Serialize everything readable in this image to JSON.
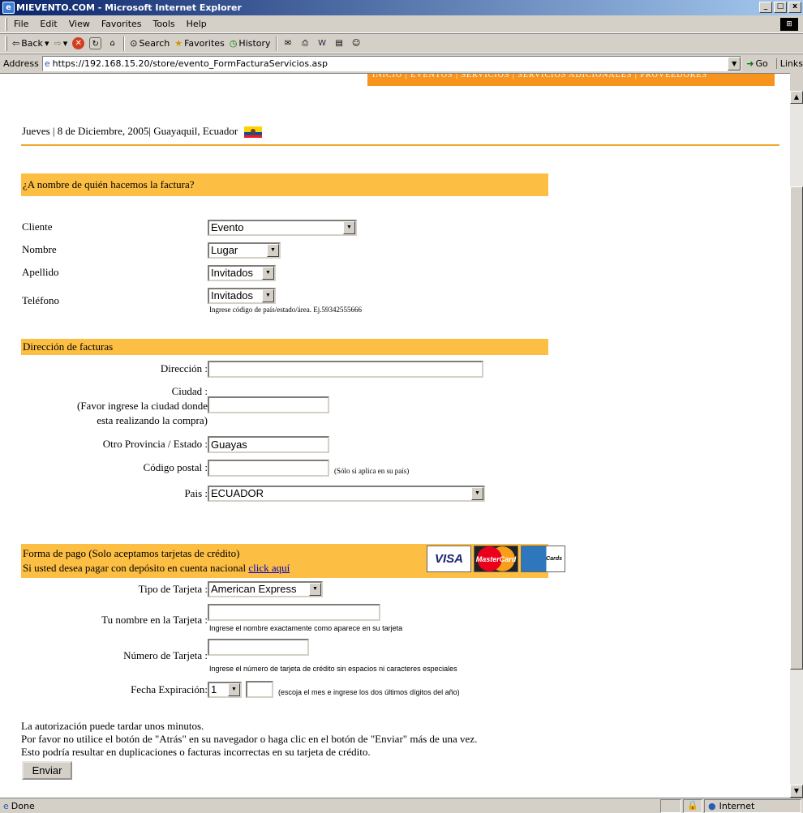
{
  "window": {
    "title": "MIEVENTO.COM - Microsoft Internet Explorer"
  },
  "menu": [
    "File",
    "Edit",
    "View",
    "Favorites",
    "Tools",
    "Help"
  ],
  "toolbar": {
    "back": "Back",
    "search": "Search",
    "favorites": "Favorites",
    "history": "History"
  },
  "address": {
    "label": "Address",
    "url": "https://192.168.15.20/store/evento_FormFacturaServicios.asp",
    "go": "Go",
    "links": "Links"
  },
  "status": {
    "text": "Done",
    "zone": "Internet"
  },
  "page": {
    "topnav": "INICIO | EVENTOS | SERVICIOS | SERVICIOS ADICIONALES | PROVEEDORES",
    "date": "Jueves | 8 de Diciembre, 2005| Guayaquil, Ecuador",
    "billing_header": "¿A nombre de quién hacemos la factura?",
    "billing": {
      "cliente_label": "Cliente",
      "cliente_value": "Evento",
      "nombre_label": "Nombre",
      "nombre_value": "Lugar",
      "apellido_label": "Apellido",
      "apellido_value": "Invitados",
      "telefono_label": "Teléfono",
      "telefono_value": "Invitados",
      "telefono_hint": "Ingrese código de país/estado/área. Ej.59342555666"
    },
    "address_header": "Dirección de facturas",
    "address": {
      "direccion_label": "Dirección :",
      "direccion_value": "",
      "ciudad_label_1": "Ciudad :",
      "ciudad_label_2": "(Favor ingrese la ciudad donde",
      "ciudad_label_3": "esta realizando la compra)",
      "ciudad_value": "",
      "provincia_label": "Otro Provincia / Estado :",
      "provincia_value": "Guayas",
      "postal_label": "Código postal :",
      "postal_value": "",
      "postal_hint": "(Sólo si aplica en su país)",
      "pais_label": "Pais :",
      "pais_value": "ECUADOR"
    },
    "payment_header_1": "Forma de pago (Solo aceptamos tarjetas de crédito)",
    "payment_header_2": "Si usted desea pagar con depósito en cuenta nacional",
    "payment_link": "click aquí",
    "cards": {
      "visa": "VISA",
      "mastercard": "MasterCard",
      "amex": "Cards"
    },
    "payment": {
      "tipo_label": "Tipo de Tarjeta :",
      "tipo_value": "American Express",
      "nombre_label": "Tu nombre en la Tarjeta :",
      "nombre_value": "",
      "nombre_hint": "Ingrese el nombre exactamente como aparece en su tarjeta",
      "numero_label": "Número de Tarjeta :",
      "numero_value": "",
      "numero_hint": "Ingrese el número de tarjeta de crédito sin espacios ni caracteres especiales",
      "fecha_label": "Fecha Expiración:",
      "mes_value": "1",
      "anio_value": "",
      "fecha_hint": "(escoja el mes e ingrese los dos últimos dígitos del año)"
    },
    "notes": [
      "La autorización puede tardar unos minutos.",
      "Por favor no utilice el botón de \"Atrás\" en su navegador o haga clic en el botón de \"Enviar\" más de una vez.",
      "Esto podría resultar en duplicaciones o facturas incorrectas en su tarjeta de crédito."
    ],
    "submit": "Enviar"
  }
}
